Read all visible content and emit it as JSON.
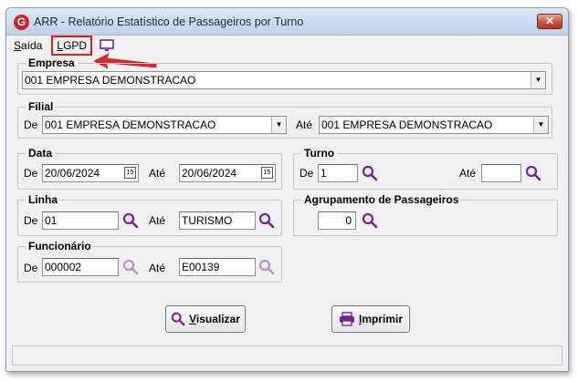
{
  "window": {
    "title": "ARR - Relatório Estatístico de Passageiros por Turno",
    "logo_letter": "G",
    "close_glyph": "✕"
  },
  "menu": {
    "saida_first": "S",
    "saida_rest": "aída",
    "lgpd_first": "L",
    "lgpd_rest": "GPD",
    "monitor_icon": "monitor-icon"
  },
  "empresa": {
    "legend": "Empresa",
    "value": "001 EMPRESA DEMONSTRACAO"
  },
  "filial": {
    "legend": "Filial",
    "de_label": "De",
    "ate_label": "Até",
    "de_value": "001 EMPRESA DEMONSTRACAO",
    "ate_value": "001 EMPRESA DEMONSTRACAO"
  },
  "data": {
    "legend": "Data",
    "de_label": "De",
    "ate_label": "Até",
    "de_value": "20/06/2024",
    "ate_value": "20/06/2024",
    "calendar_glyph": "15"
  },
  "turno": {
    "legend": "Turno",
    "de_label": "De",
    "ate_label": "Até",
    "de_value": "1",
    "ate_value": ""
  },
  "linha": {
    "legend": "Linha",
    "de_label": "De",
    "ate_label": "Até",
    "de_value": "01",
    "ate_value": "TURISMO"
  },
  "agrupamento": {
    "legend": "Agrupamento de Passageiros",
    "value": "0"
  },
  "funcionario": {
    "legend": "Funcionário",
    "de_label": "De",
    "ate_label": "Até",
    "de_value": "000002",
    "ate_value": "E00139"
  },
  "buttons": {
    "visualizar_first": "V",
    "visualizar_rest": "isualizar",
    "imprimir_first": "I",
    "imprimir_rest": "mprimir"
  },
  "colors": {
    "accent": "#7b1fa2",
    "highlight": "#e01c1c",
    "close": "#c8543f"
  }
}
